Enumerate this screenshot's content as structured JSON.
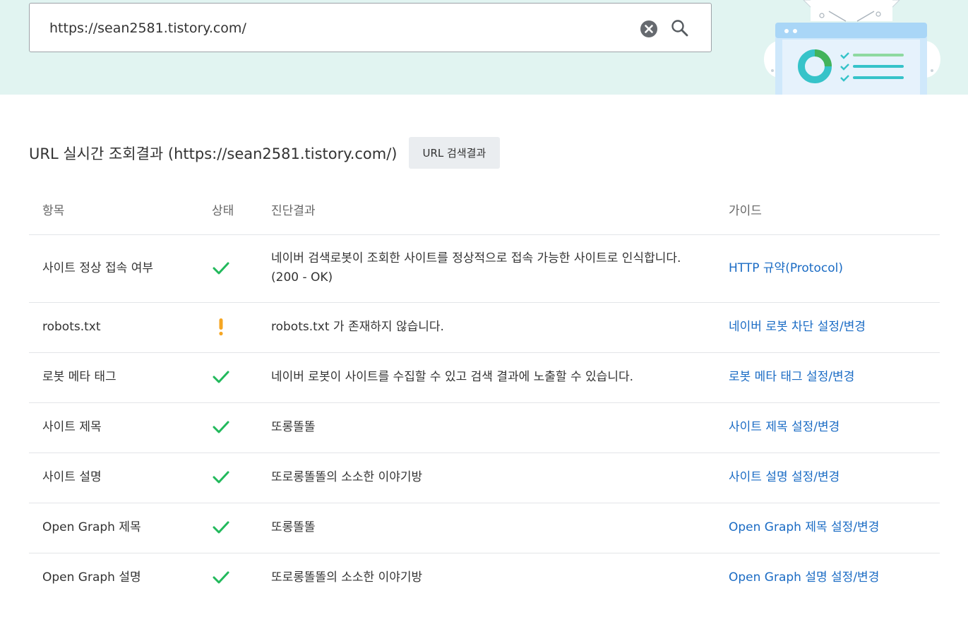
{
  "search": {
    "value": "https://sean2581.tistory.com/",
    "clear_icon": "close-circle-icon",
    "search_icon": "search-icon"
  },
  "colors": {
    "band_bg": "#e1f4f1",
    "check_green": "#22b95c",
    "warn_orange": "#f5a623",
    "link_blue": "#1a6bc4"
  },
  "result": {
    "title": "URL 실시간 조회결과 (https://sean2581.tistory.com/)",
    "url_search_button": "URL 검색결과"
  },
  "table": {
    "headers": {
      "item": "항목",
      "status": "상태",
      "result": "진단결과",
      "guide": "가이드"
    },
    "rows": [
      {
        "item": "사이트 정상 접속 여부",
        "status": "ok",
        "result": "네이버 검색로봇이 조회한 사이트를 정상적으로 접속 가능한 사이트로 인식합니다.",
        "result_detail": "(200 - OK)",
        "guide": "HTTP 규약(Protocol)"
      },
      {
        "item": "robots.txt",
        "status": "warning",
        "result": "robots.txt 가 존재하지 않습니다.",
        "guide": "네이버 로봇 차단 설정/변경"
      },
      {
        "item": "로봇 메타 태그",
        "status": "ok",
        "result": "네이버 로봇이 사이트를 수집할 수 있고 검색 결과에 노출할 수 있습니다.",
        "guide": "로봇 메타 태그 설정/변경"
      },
      {
        "item": "사이트 제목",
        "status": "ok",
        "result": "또롱똘똘",
        "guide": "사이트 제목 설정/변경"
      },
      {
        "item": "사이트 설명",
        "status": "ok",
        "result": "또로롱똘똘의 소소한 이야기방",
        "guide": "사이트 설명 설정/변경"
      },
      {
        "item": "Open Graph 제목",
        "status": "ok",
        "result": "또롱똘똘",
        "guide": "Open Graph 제목 설정/변경"
      },
      {
        "item": "Open Graph 설명",
        "status": "ok",
        "result": "또로롱똘똘의 소소한 이야기방",
        "guide": "Open Graph 설명 설정/변경"
      }
    ]
  }
}
